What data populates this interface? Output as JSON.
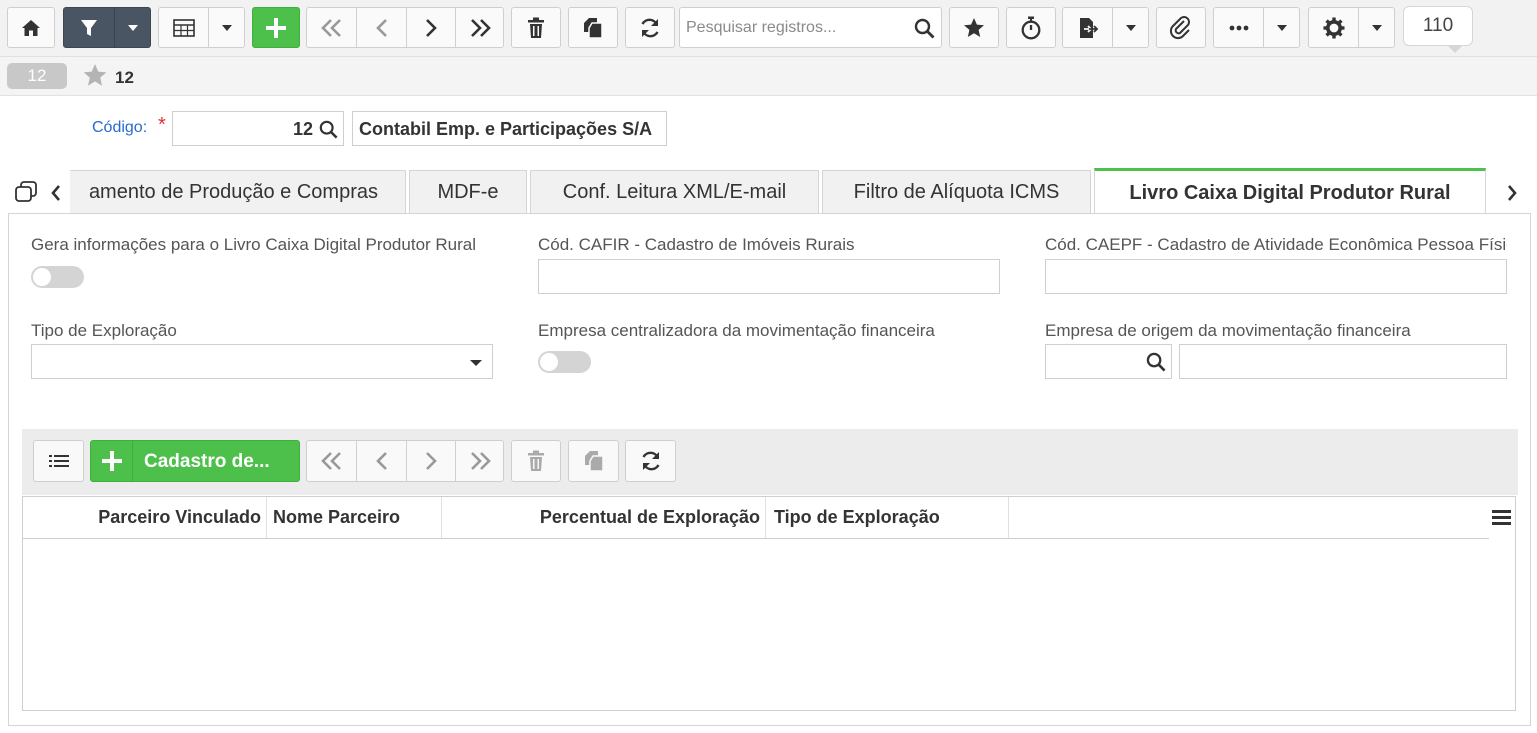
{
  "toolbar": {
    "search_placeholder": "Pesquisar registros...",
    "record_count": "110"
  },
  "record": {
    "badge": "12",
    "title": "12"
  },
  "form": {
    "code_label": "Código:",
    "required_mark": "*",
    "code_value": "12",
    "company_name": "Contabil Emp. e Participações S/A"
  },
  "tabs": [
    {
      "label": "amento de Produção e Compras"
    },
    {
      "label": "MDF-e"
    },
    {
      "label": "Conf. Leitura XML/E-mail"
    },
    {
      "label": "Filtro de Alíquota ICMS"
    },
    {
      "label": "Livro Caixa Digital Produtor Rural"
    }
  ],
  "fields": {
    "gera_info_label": "Gera informações para o Livro Caixa Digital Produtor Rural",
    "cafir_label": "Cód. CAFIR - Cadastro de Imóveis Rurais",
    "caepf_label": "Cód. CAEPF - Cadastro de Atividade Econômica Pessoa Física",
    "tipo_exploracao_label": "Tipo de Exploração",
    "empresa_centralizadora_label": "Empresa centralizadora da movimentação financeira",
    "empresa_origem_label": "Empresa de origem da movimentação financeira"
  },
  "grid": {
    "add_label": "Cadastro de...",
    "columns": [
      "Parceiro Vinculado",
      "Nome Parceiro",
      "Percentual de Exploração",
      "Tipo de Exploração"
    ]
  },
  "colors": {
    "accent_green": "#4cc04a",
    "toolbar_dark": "#4a5563",
    "link_blue": "#2a6ad0"
  }
}
